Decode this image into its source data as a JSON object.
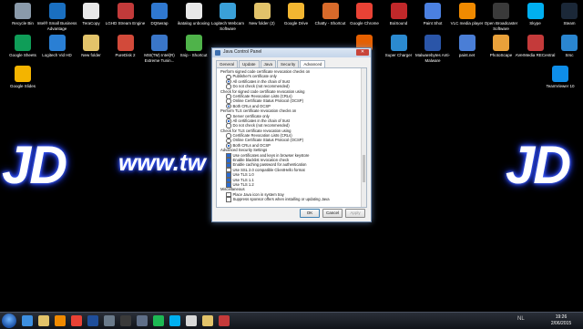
{
  "desktop": {
    "wallpaper_jd_left": "JD",
    "wallpaper_url": "www.tw          declerck",
    "wallpaper_jd_right": "JD",
    "icons_row1": [
      {
        "label": "Recycle Bin",
        "color": "#8a9aaa"
      },
      {
        "label": "Intel® Small Business Advantage",
        "color": "#1a6fc0"
      },
      {
        "label": "TeraCopy",
        "color": "#e8e8e8"
      },
      {
        "label": "LGHD Stream Engine",
        "color": "#c23a3a"
      },
      {
        "label": "DQ6wrap",
        "color": "#2f78d0"
      },
      {
        "label": "ikatalog unboxing",
        "color": "#e8e8e8"
      },
      {
        "label": "Logitech Webcam Software",
        "color": "#3aa0d8"
      },
      {
        "label": "New folder (2)",
        "color": "#e2c36a"
      },
      {
        "label": "Google Drive",
        "color": "#f2b631"
      },
      {
        "label": "Chatty - Shortcut",
        "color": "#d86a2a"
      },
      {
        "label": "Google Chrome",
        "color": "#e94235"
      },
      {
        "label": "BoiSound",
        "color": "#c0282a"
      },
      {
        "label": "Paint Shot",
        "color": "#4b80e0"
      },
      {
        "label": "VLC media player",
        "color": "#f08a00"
      },
      {
        "label": "Open Broadcaster Software",
        "color": "#3a3a3a"
      },
      {
        "label": "Skype",
        "color": "#00aff0"
      },
      {
        "label": "Steam",
        "color": "#1b2838"
      }
    ],
    "icons_row2": [
      {
        "label": "Google Sheets",
        "color": "#0f9d58"
      },
      {
        "label": "Logitech Vid HD",
        "color": "#2a7fd4"
      },
      {
        "label": "New folder",
        "color": "#e2c36a"
      },
      {
        "label": "PureDisk 2",
        "color": "#d24a3a"
      },
      {
        "label": "MSI(TM) Intel(R) Extreme Tunin...",
        "color": "#3a76c8"
      },
      {
        "label": "Snip - Shortcut",
        "color": "#4fb34a"
      },
      {
        "label": "",
        "color": "#ffffff"
      },
      {
        "label": "",
        "color": "#ffffff"
      },
      {
        "label": "",
        "color": "#ffffff"
      },
      {
        "label": "",
        "color": "#ffffff"
      },
      {
        "label": "Firefox",
        "color": "#e66000"
      },
      {
        "label": "Super Charger",
        "color": "#2b8ad0"
      },
      {
        "label": "Malwarebytes Anti-Malware",
        "color": "#2a55a8"
      },
      {
        "label": "paint.net",
        "color": "#4a7ed6"
      },
      {
        "label": "PhotoScape",
        "color": "#e9a13a"
      },
      {
        "label": "AVerMedia RECentral",
        "color": "#c43a3a"
      },
      {
        "label": "Srsc",
        "color": "#2a86d0"
      }
    ],
    "icons_row3": [
      {
        "label": "Google Slides",
        "color": "#f4b400"
      },
      {
        "label": "TeamViewer 10",
        "color": "#0e8ee9"
      }
    ]
  },
  "dialog": {
    "title": "Java Control Panel",
    "close": "✕",
    "tabs": [
      "General",
      "Update",
      "Java",
      "Security",
      "Advanced"
    ],
    "active_tab": "Advanced",
    "rows": [
      {
        "text": "Perform signed code certificate revocation checks on",
        "kind": "header"
      },
      {
        "text": "Publisher's certificate only",
        "kind": "radio",
        "on": false
      },
      {
        "text": "All certificates in the chain of trust",
        "kind": "radio",
        "on": true
      },
      {
        "text": "Do not check (not recommended)",
        "kind": "radio",
        "on": false
      },
      {
        "text": "Check for signed code certificate revocation using",
        "kind": "header"
      },
      {
        "text": "Certificate Revocation Lists (CRLs)",
        "kind": "radio",
        "on": false
      },
      {
        "text": "Online Certificate Status Protocol (OCSP)",
        "kind": "radio",
        "on": false
      },
      {
        "text": "Both CRLs and OCSP",
        "kind": "radio",
        "on": true
      },
      {
        "text": "Perform TLS certificate revocation checks on",
        "kind": "header"
      },
      {
        "text": "Server certificate only",
        "kind": "radio",
        "on": false
      },
      {
        "text": "All certificates in the chain of trust",
        "kind": "radio",
        "on": true
      },
      {
        "text": "Do not check (not recommended)",
        "kind": "radio",
        "on": false
      },
      {
        "text": "Check for TLS certificate revocation using",
        "kind": "header"
      },
      {
        "text": "Certificate Revocation Lists (CRLs)",
        "kind": "radio",
        "on": false
      },
      {
        "text": "Online Certificate Status Protocol (OCSP)",
        "kind": "radio",
        "on": false
      },
      {
        "text": "Both CRLs and OCSP",
        "kind": "radio",
        "on": true
      },
      {
        "text": "Advanced Security Settings",
        "kind": "header"
      },
      {
        "text": "Use certificates and keys in browser keystore",
        "kind": "check",
        "on": true
      },
      {
        "text": "Enable blacklist revocation check",
        "kind": "check",
        "on": true
      },
      {
        "text": "Enable caching password for authentication",
        "kind": "check",
        "on": true
      },
      {
        "text": "Use SSL 2.0 compatible ClientHello format",
        "kind": "check",
        "on": false
      },
      {
        "text": "Use TLS 1.0",
        "kind": "check",
        "on": true
      },
      {
        "text": "Use TLS 1.1",
        "kind": "check",
        "on": true
      },
      {
        "text": "Use TLS 1.2",
        "kind": "check",
        "on": true
      },
      {
        "text": "Miscellaneous",
        "kind": "header"
      },
      {
        "text": "Place Java icon in system tray",
        "kind": "check",
        "on": false
      },
      {
        "text": "Suppress sponsor offers when installing or updating Java",
        "kind": "check",
        "on": false
      }
    ],
    "buttons": {
      "ok": "OK",
      "cancel": "Cancel",
      "apply": "Apply"
    }
  },
  "taskbar": {
    "items": [
      {
        "name": "ie-icon",
        "color": "#3d8fe0"
      },
      {
        "name": "explorer-icon",
        "color": "#e2c36a"
      },
      {
        "name": "media-player-icon",
        "color": "#f08a00"
      },
      {
        "name": "chrome-icon",
        "color": "#e94235"
      },
      {
        "name": "photoshop-icon",
        "color": "#1f4e9a"
      },
      {
        "name": "steam-icon",
        "color": "#6a7a8a"
      },
      {
        "name": "obs-icon",
        "color": "#3a3a3a"
      },
      {
        "name": "app-icon",
        "color": "#5f6f88"
      },
      {
        "name": "spotify-icon",
        "color": "#1db954"
      },
      {
        "name": "skype-icon",
        "color": "#00aff0"
      },
      {
        "name": "java-icon",
        "color": "#d8d8d8"
      },
      {
        "name": "folder-icon",
        "color": "#e2c36a"
      },
      {
        "name": "app2-icon",
        "color": "#c43a3a"
      }
    ],
    "lang": "NL",
    "time": "19:26",
    "date": "2/06/2015"
  }
}
